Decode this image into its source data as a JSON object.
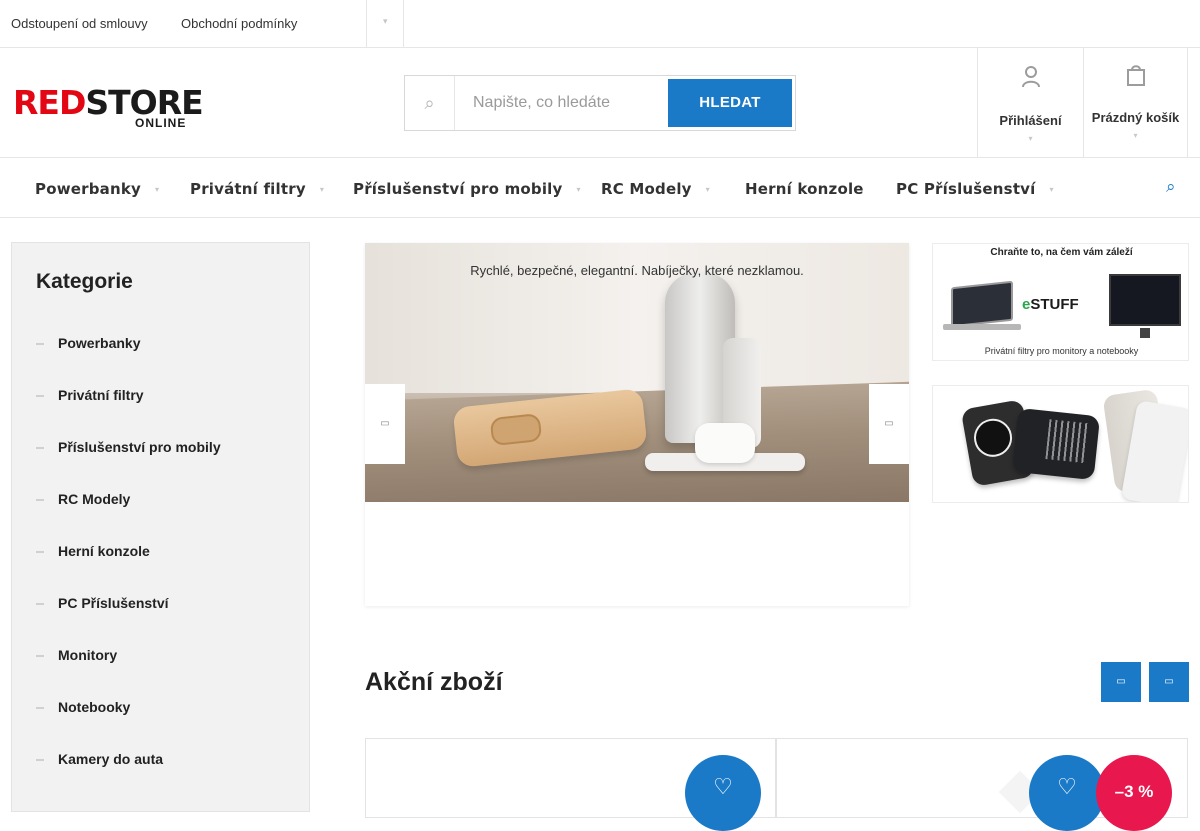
{
  "topbar": {
    "links": [
      "Odstoupení od smlouvy",
      "Obchodní podmínky"
    ],
    "more_glyph": "▾"
  },
  "header": {
    "logo": {
      "part1": "RED",
      "part2": "STORE",
      "part3": "ONLINE"
    },
    "search": {
      "placeholder": "Napište, co hledáte",
      "value": "",
      "button_label": "HLEDAT"
    },
    "login_label": "Přihlášení",
    "cart_label": "Prázdný košík"
  },
  "nav": {
    "items": [
      "Powerbanky",
      "Privátní filtry",
      "Příslušenství pro mobily",
      "RC Modely",
      "Herní konzole",
      "PC Příslušenství"
    ]
  },
  "sidebar": {
    "title": "Kategorie",
    "items": [
      "Powerbanky",
      "Privátní filtry",
      "Příslušenství pro mobily",
      "RC Modely",
      "Herní konzole",
      "PC Příslušenství",
      "Monitory",
      "Notebooky",
      "Kamery do auta"
    ]
  },
  "hero": {
    "caption": "Rychlé, bezpečné, elegantní. Nabíječky, které nezklamou."
  },
  "side_banners": {
    "filters": {
      "headline": "Chraňte to, na čem vám záleží",
      "brand_e": "e",
      "brand_rest": "STUFF",
      "footer": "Privátní filtry pro monitory a notebooky"
    }
  },
  "sale": {
    "title": "Akční zboží",
    "cards": [
      {
        "discount": ""
      },
      {
        "discount": "–3 %"
      }
    ]
  },
  "colors": {
    "accent": "#1a7ac7",
    "brand_red": "#e30613",
    "discount": "#e8174d"
  }
}
